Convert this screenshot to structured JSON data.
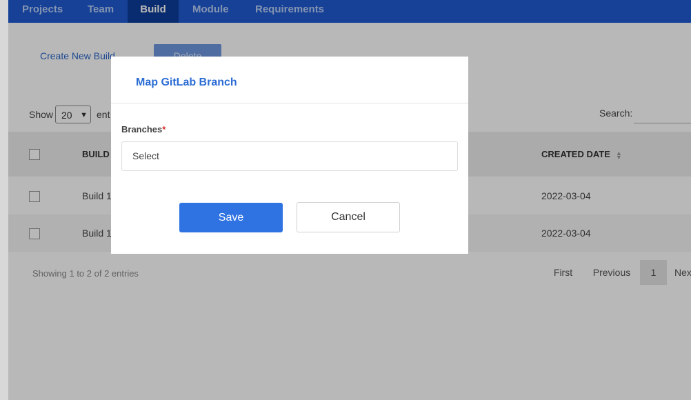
{
  "nav": {
    "items": [
      {
        "label": "Projects"
      },
      {
        "label": "Team"
      },
      {
        "label": "Build"
      },
      {
        "label": "Module"
      },
      {
        "label": "Requirements"
      }
    ],
    "active": "Build"
  },
  "toolbar": {
    "create_label": "Create New Build",
    "delete_label": "Delete"
  },
  "table_controls": {
    "show_label": "Show",
    "show_value": "20",
    "show_suffix": "ent",
    "search_label": "Search:"
  },
  "table": {
    "columns": [
      "BUILD",
      "CREATED DATE"
    ],
    "rows": [
      {
        "build": "Build 1",
        "created": "2022-03-04"
      },
      {
        "build": "Build 1",
        "created": "2022-03-04"
      }
    ]
  },
  "footer": {
    "showing": "Showing 1 to 2 of 2 entries",
    "pagination": {
      "first": "First",
      "previous": "Previous",
      "current": "1",
      "next": "Nex"
    }
  },
  "modal": {
    "title": "Map GitLab Branch",
    "field_label": "Branches",
    "required_mark": "*",
    "select_value": "Select",
    "save_label": "Save",
    "cancel_label": "Cancel"
  },
  "colors": {
    "nav_bg": "#1f5bd1",
    "nav_active_bg": "#0c3d9a",
    "accent": "#2f73e3",
    "title": "#2b6cd4",
    "required": "#d32f2f"
  }
}
